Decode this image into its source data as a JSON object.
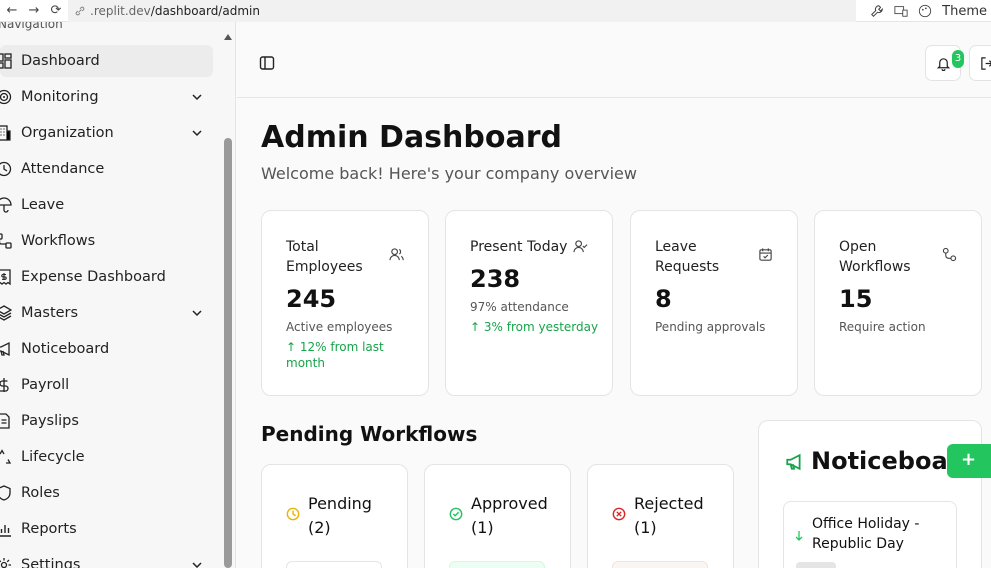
{
  "browser": {
    "url_prefix": ".replit.dev",
    "url_path": "/dashboard/admin",
    "theme_label": "Theme"
  },
  "sidebar": {
    "group_label": "Navigation",
    "items": [
      {
        "label": "Dashboard",
        "icon": "dashboard-icon",
        "active": true
      },
      {
        "label": "Monitoring",
        "icon": "target-icon",
        "expandable": true
      },
      {
        "label": "Organization",
        "icon": "building-icon",
        "expandable": true
      },
      {
        "label": "Attendance",
        "icon": "clock-icon"
      },
      {
        "label": "Leave",
        "icon": "umbrella-icon"
      },
      {
        "label": "Workflows",
        "icon": "workflow-icon"
      },
      {
        "label": "Expense Dashboard",
        "icon": "receipt-icon"
      },
      {
        "label": "Masters",
        "icon": "layers-icon",
        "expandable": true
      },
      {
        "label": "Noticeboard",
        "icon": "megaphone-icon"
      },
      {
        "label": "Payroll",
        "icon": "dollar-icon"
      },
      {
        "label": "Payslips",
        "icon": "file-icon"
      },
      {
        "label": "Lifecycle",
        "icon": "recycle-icon"
      },
      {
        "label": "Roles",
        "icon": "shield-icon"
      },
      {
        "label": "Reports",
        "icon": "bar-chart-icon"
      },
      {
        "label": "Settings",
        "icon": "gear-icon",
        "expandable": true
      }
    ]
  },
  "header": {
    "notification_count": "3"
  },
  "main": {
    "title": "Admin Dashboard",
    "subtitle": "Welcome back! Here's your company overview",
    "stats": [
      {
        "label": "Total Employees",
        "value": "245",
        "desc": "Active employees",
        "trend": "↑ 12% from last month",
        "icon": "users-icon"
      },
      {
        "label": "Present Today",
        "value": "238",
        "desc": "97% attendance",
        "trend": "↑ 3% from yesterday",
        "icon": "user-check-icon"
      },
      {
        "label": "Leave Requests",
        "value": "8",
        "desc": "Pending approvals",
        "trend": "",
        "icon": "calendar-check-icon"
      },
      {
        "label": "Open Workflows",
        "value": "15",
        "desc": "Require action",
        "trend": "",
        "icon": "workflow-icon"
      }
    ],
    "pending_workflows": {
      "title": "Pending Workflows",
      "cards": [
        {
          "label": "Pending (2)",
          "color": "#eab308",
          "icon": "clock-icon"
        },
        {
          "label": "Approved (1)",
          "color": "#22c55e",
          "icon": "check-circle-icon"
        },
        {
          "label": "Rejected (1)",
          "color": "#dc2626",
          "icon": "x-circle-icon"
        }
      ]
    },
    "noticeboard": {
      "title": "Noticeboard",
      "add_label": "+",
      "items": [
        {
          "title": "Office Holiday - Republic Day"
        }
      ]
    }
  },
  "colors": {
    "accent_green": "#22c55e",
    "trend_green": "#16a34a"
  }
}
